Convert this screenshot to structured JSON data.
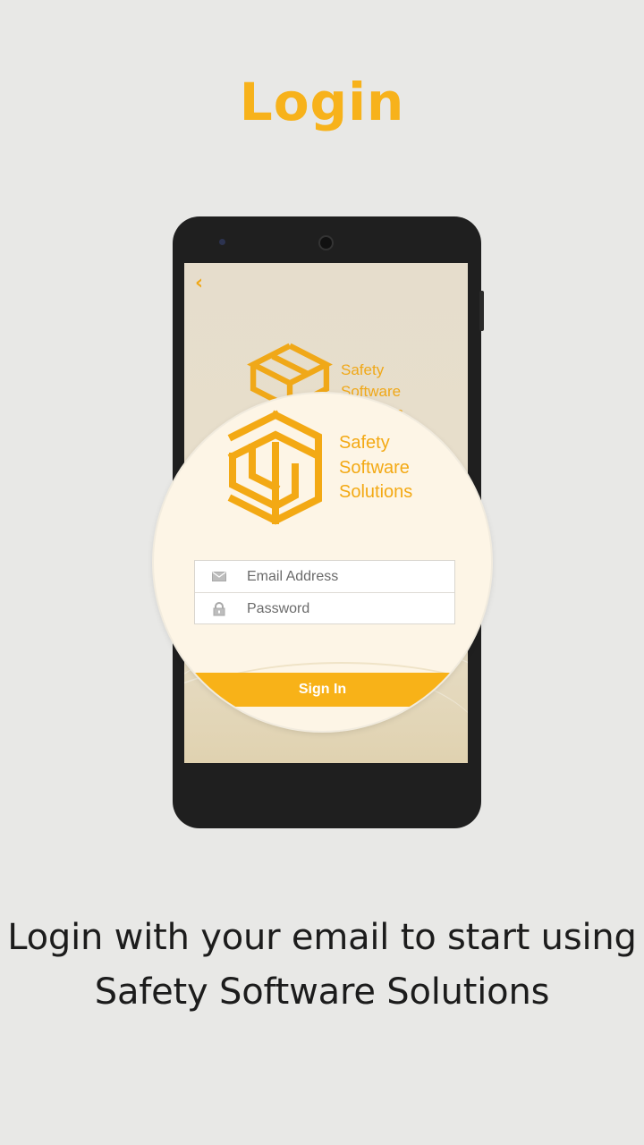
{
  "page": {
    "title": "Login",
    "caption_line1": "Login with your email to start using",
    "caption_line2": "Safety Software Solutions"
  },
  "app": {
    "logo_text_line1": "Safety",
    "logo_text_line2": "Software",
    "logo_text_line3": "Solutions"
  },
  "form": {
    "email_placeholder": "Email Address",
    "password_placeholder": "Password",
    "sign_in_label": "Sign In"
  },
  "colors": {
    "accent": "#f8b218",
    "background": "#e8e8e6",
    "phone_body": "#1f1f1f"
  },
  "icons": {
    "back": "chevron-left-icon",
    "email": "envelope-icon",
    "password": "lock-icon"
  }
}
